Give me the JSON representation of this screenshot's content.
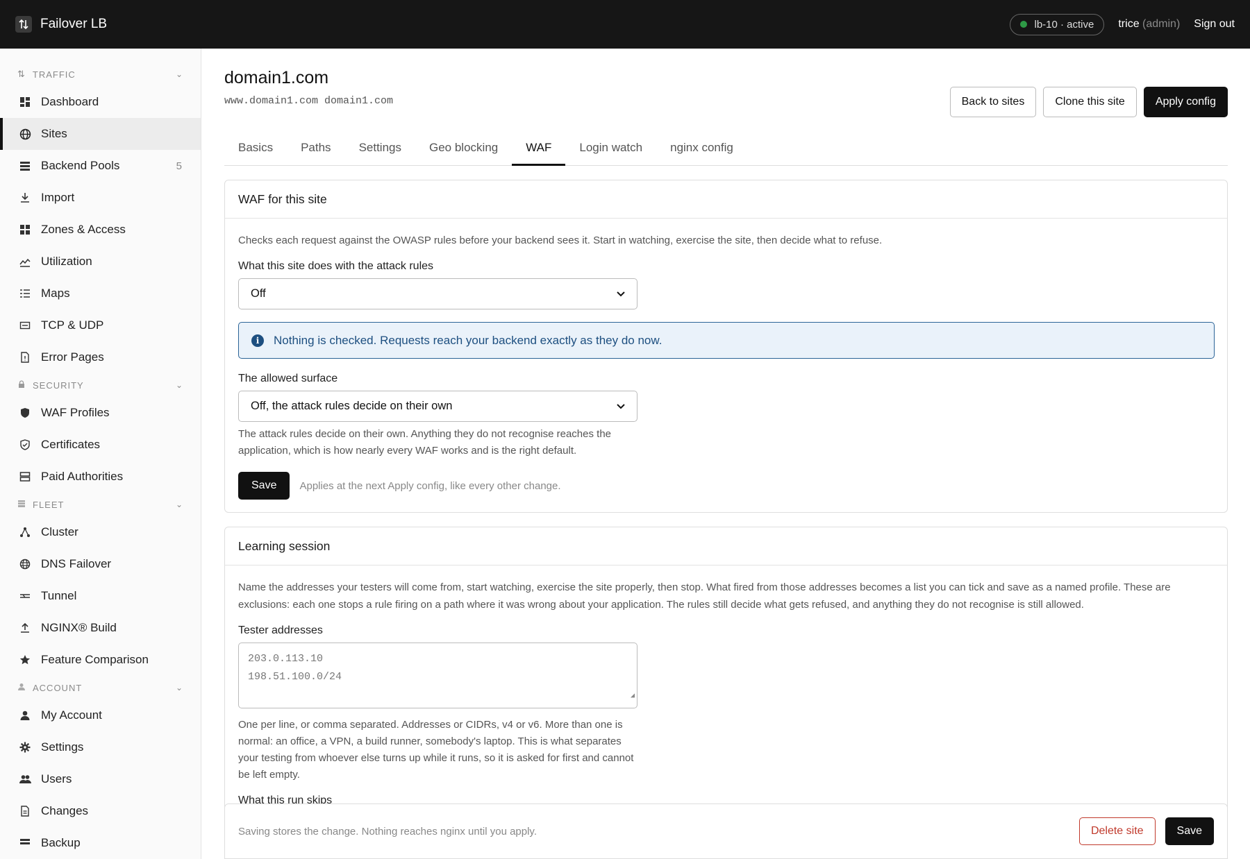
{
  "app": {
    "name": "Failover LB",
    "status": "lb-10 · active",
    "user": "trice",
    "role": "(admin)",
    "signout": "Sign out",
    "status_color": "#2e9a46"
  },
  "sidebar": {
    "sections": [
      {
        "title": "TRAFFIC",
        "icon": "traffic-icon",
        "items": [
          {
            "label": "Dashboard",
            "icon": "dashboard-icon"
          },
          {
            "label": "Sites",
            "icon": "globe-icon",
            "active": true
          },
          {
            "label": "Backend Pools",
            "icon": "server-icon",
            "count": "5"
          },
          {
            "label": "Import",
            "icon": "import-icon"
          },
          {
            "label": "Zones & Access",
            "icon": "grid-icon"
          },
          {
            "label": "Utilization",
            "icon": "chart-icon"
          },
          {
            "label": "Maps",
            "icon": "list-icon"
          },
          {
            "label": "TCP & UDP",
            "icon": "port-icon"
          },
          {
            "label": "Error Pages",
            "icon": "file-icon"
          }
        ]
      },
      {
        "title": "SECURITY",
        "icon": "lock-icon",
        "items": [
          {
            "label": "WAF Profiles",
            "icon": "shield-icon"
          },
          {
            "label": "Certificates",
            "icon": "shield-check-icon"
          },
          {
            "label": "Paid Authorities",
            "icon": "database-icon"
          }
        ]
      },
      {
        "title": "FLEET",
        "icon": "fleet-icon",
        "items": [
          {
            "label": "Cluster",
            "icon": "cluster-icon"
          },
          {
            "label": "DNS Failover",
            "icon": "dns-icon"
          },
          {
            "label": "Tunnel",
            "icon": "tunnel-icon"
          },
          {
            "label": "NGINX® Build",
            "icon": "upload-icon"
          },
          {
            "label": "Feature Comparison",
            "icon": "star-icon"
          }
        ]
      },
      {
        "title": "ACCOUNT",
        "icon": "account-icon",
        "items": [
          {
            "label": "My Account",
            "icon": "person-icon"
          },
          {
            "label": "Settings",
            "icon": "gear-icon"
          },
          {
            "label": "Users",
            "icon": "users-icon"
          },
          {
            "label": "Changes",
            "icon": "document-icon"
          },
          {
            "label": "Backup",
            "icon": "backup-icon"
          }
        ]
      }
    ]
  },
  "page": {
    "title": "domain1.com",
    "subtitle": "www.domain1.com domain1.com",
    "actions": {
      "back": "Back to sites",
      "clone": "Clone this site",
      "apply": "Apply config"
    },
    "tabs": [
      "Basics",
      "Paths",
      "Settings",
      "Geo blocking",
      "WAF",
      "Login watch",
      "nginx config"
    ],
    "active_tab": "WAF"
  },
  "waf": {
    "title": "WAF for this site",
    "desc": "Checks each request against the OWASP rules before your backend sees it. Start in watching, exercise the site, then decide what to refuse.",
    "mode_label": "What this site does with the attack rules",
    "mode_value": "Off",
    "info": "Nothing is checked. Requests reach your backend exactly as they do now.",
    "surface_label": "The allowed surface",
    "surface_value": "Off, the attack rules decide on their own",
    "surface_help": "The attack rules decide on their own. Anything they do not recognise reaches the application, which is how nearly every WAF works and is the right default.",
    "save": "Save",
    "save_note": "Applies at the next Apply config, like every other change."
  },
  "learning": {
    "title": "Learning session",
    "desc": "Name the addresses your testers will come from, start watching, exercise the site properly, then stop. What fired from those addresses becomes a list you can tick and save as a named profile. These are exclusions: each one stops a rule firing on a path where it was wrong about your application. The rules still decide what gets refused, and anything they do not recognise is still allowed.",
    "testers_label": "Tester addresses",
    "testers_placeholder_1": "203.0.113.10",
    "testers_placeholder_2": "198.51.100.0/24",
    "testers_help": "One per line, or comma separated. Addresses or CIDRs, v4 or v6. More than one is normal: an office, a VPN, a build runner, somebody's laptop. This is what separates your testing from whoever else turns up while it runs, so it is asked for first and cannot be left empty.",
    "next_label": "What this run skips"
  },
  "footer": {
    "note": "Saving stores the change. Nothing reaches nginx until you apply.",
    "delete": "Delete site",
    "save": "Save"
  }
}
